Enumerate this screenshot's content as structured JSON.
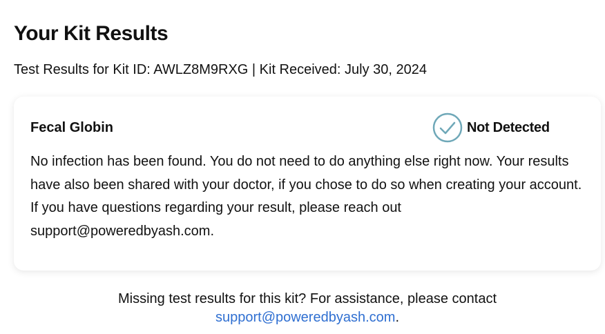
{
  "page": {
    "title": "Your Kit Results",
    "subtitle": "Test Results for Kit ID: AWLZ8M9RXG | Kit Received: July 30, 2024"
  },
  "result_card": {
    "test_name": "Fecal Globin",
    "status_icon": "check-circle-icon",
    "status_label": "Not Detected",
    "status_color": "#6fa8b8",
    "description": "No infection has been found. You do not need to do anything else right now. Your results have also been shared with your doctor, if you chose to do so when creating your account. If you have questions regarding your result, please reach out support@poweredbyash.com."
  },
  "footer": {
    "text": "Missing test results for this kit? For assistance, please contact",
    "email": "support@poweredbyash.com",
    "trailing": ".",
    "link_color": "#2f6fd1"
  }
}
